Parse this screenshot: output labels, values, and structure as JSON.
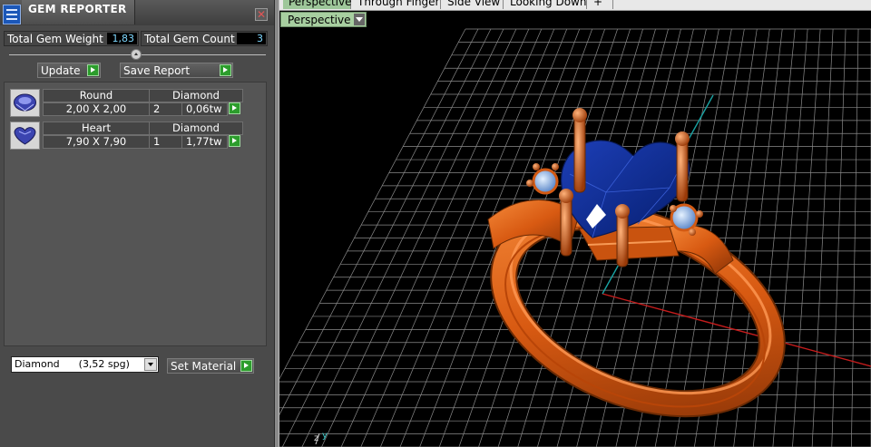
{
  "panel": {
    "title": "GEM REPORTER",
    "close_label": "✕",
    "stats": {
      "weight_label": "Total Gem Weight",
      "weight_value": "1,83",
      "count_label": "Total Gem Count",
      "count_value": "3"
    },
    "buttons": {
      "update": "Update",
      "save_report": "Save Report"
    },
    "gems": [
      {
        "cut": "Round",
        "material": "Diamond",
        "size": "2,00 X 2,00",
        "qty": "2",
        "weight": "0,06tw"
      },
      {
        "cut": "Heart",
        "material": "Diamond",
        "size": "7,90 X 7,90",
        "qty": "1",
        "weight": "1,77tw"
      }
    ],
    "material_select": {
      "value": "Diamond      (3,52 spg)"
    },
    "set_material": "Set Material"
  },
  "viewport": {
    "tabs": [
      "Perspective",
      "Through Finger",
      "Side View",
      "Looking Down",
      "+"
    ],
    "active_tab": "Perspective",
    "view_label": "Perspective",
    "axis_labels": {
      "z": "z",
      "y": "y"
    }
  },
  "colors": {
    "panel_bg": "#4a4a4a",
    "accent_green": "#2c9d2c",
    "metal": "#e0621a",
    "gem_blue": "#0b2f8f",
    "grid": "#8a8a8a",
    "x_axis": "#c41c1c",
    "y_axis": "#1aa3a3"
  }
}
